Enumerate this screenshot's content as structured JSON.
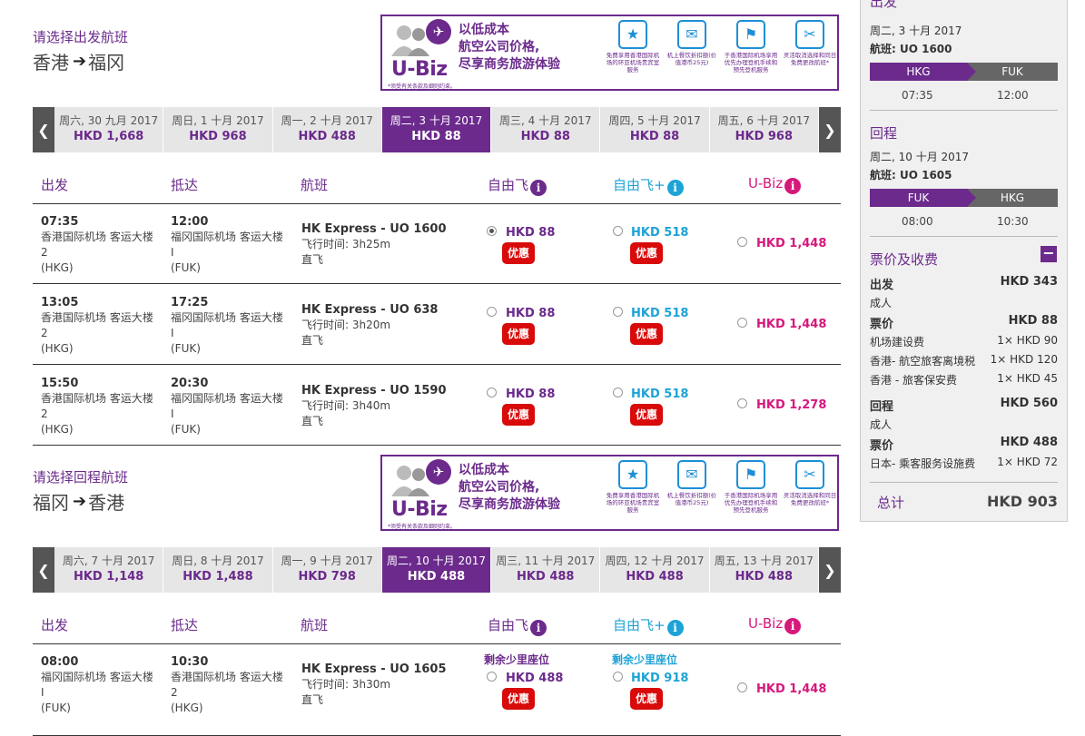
{
  "outbound": {
    "title": "请选择出发航班",
    "from": "香港",
    "to": "福冈",
    "dates": [
      {
        "date": "周六, 30 九月 2017",
        "price": "HKD 1,668"
      },
      {
        "date": "周日, 1 十月 2017",
        "price": "HKD 968"
      },
      {
        "date": "周一, 2 十月 2017",
        "price": "HKD 488"
      },
      {
        "date": "周二, 3 十月 2017",
        "price": "HKD 88",
        "selected": true
      },
      {
        "date": "周三, 4 十月 2017",
        "price": "HKD 88"
      },
      {
        "date": "周四, 5 十月 2017",
        "price": "HKD 88"
      },
      {
        "date": "周五, 6 十月 2017",
        "price": "HKD 968"
      }
    ],
    "flights": [
      {
        "dep_time": "07:35",
        "dep_airport": "香港国际机场 客运大楼 2",
        "dep_code": "(HKG)",
        "arr_time": "12:00",
        "arr_airport": "福冈国际机场 客运大楼 I",
        "arr_code": "(FUK)",
        "flight": "HK Express - UO 1600",
        "duration": "飞行时间: 3h25m",
        "stops": "直飞",
        "fare1": "HKD 88",
        "fare1_tag": "优惠",
        "fare2": "HKD 518",
        "fare2_tag": "优惠",
        "fare3": "HKD 1,448"
      },
      {
        "dep_time": "13:05",
        "dep_airport": "香港国际机场 客运大楼 2",
        "dep_code": "(HKG)",
        "arr_time": "17:25",
        "arr_airport": "福冈国际机场 客运大楼 I",
        "arr_code": "(FUK)",
        "flight": "HK Express - UO 638",
        "duration": "飞行时间: 3h20m",
        "stops": "直飞",
        "fare1": "HKD 88",
        "fare1_tag": "优惠",
        "fare2": "HKD 518",
        "fare2_tag": "优惠",
        "fare3": "HKD 1,448"
      },
      {
        "dep_time": "15:50",
        "dep_airport": "香港国际机场 客运大楼 2",
        "dep_code": "(HKG)",
        "arr_time": "20:30",
        "arr_airport": "福冈国际机场 客运大楼 I",
        "arr_code": "(FUK)",
        "flight": "HK Express - UO 1590",
        "duration": "飞行时间: 3h40m",
        "stops": "直飞",
        "fare1": "HKD 88",
        "fare1_tag": "优惠",
        "fare2": "HKD 518",
        "fare2_tag": "优惠",
        "fare3": "HKD 1,278"
      }
    ]
  },
  "return": {
    "title": "请选择回程航班",
    "from": "福冈",
    "to": "香港",
    "dates": [
      {
        "date": "周六, 7 十月 2017",
        "price": "HKD 1,148"
      },
      {
        "date": "周日, 8 十月 2017",
        "price": "HKD 1,488"
      },
      {
        "date": "周一, 9 十月 2017",
        "price": "HKD 798"
      },
      {
        "date": "周二, 10 十月 2017",
        "price": "HKD 488",
        "selected": true
      },
      {
        "date": "周三, 11 十月 2017",
        "price": "HKD 488"
      },
      {
        "date": "周四, 12 十月 2017",
        "price": "HKD 488"
      },
      {
        "date": "周五, 13 十月 2017",
        "price": "HKD 488"
      }
    ],
    "flights": [
      {
        "dep_time": "08:00",
        "dep_airport": "福冈国际机场 客运大楼 I",
        "dep_code": "(FUK)",
        "arr_time": "10:30",
        "arr_airport": "香港国际机场 客运大楼 2",
        "arr_code": "(HKG)",
        "flight": "HK Express - UO 1605",
        "duration": "飞行时间: 3h30m",
        "stops": "直飞",
        "fare1_note": "剩余少里座位",
        "fare1": "HKD 488",
        "fare1_tag": "优惠",
        "fare2_note": "剩余少里座位",
        "fare2": "HKD 918",
        "fare2_tag": "优惠",
        "fare3": "HKD 1,448"
      }
    ]
  },
  "table_headers": {
    "dep": "出发",
    "arr": "抵达",
    "flight": "航班",
    "fare1": "自由飞",
    "fare2": "自由飞+",
    "fare3": "U-Biz"
  },
  "banner": {
    "logo": "U-Biz",
    "slogan1": "以低成本",
    "slogan2": "航空公司价格,",
    "slogan3": "尽享商务旅游体验",
    "fine": "*须受有关条款及细则约束。",
    "features": [
      "免费享用香港国际机场的环亚机场贵宾室服务",
      "机上餐饮折扣额(价值港币25元)",
      "于香港国际机场享用优先办理登机手续和预先登机服务",
      "灵活取消选择和同日免费更改航班*"
    ]
  },
  "sidebar": {
    "dep_heading": "出发",
    "dep_date": "周二, 3 十月 2017",
    "dep_flight": "航班: UO 1600",
    "dep_from": "HKG",
    "dep_to": "FUK",
    "dep_time_from": "07:35",
    "dep_time_to": "12:00",
    "ret_heading": "回程",
    "ret_date": "周二, 10 十月 2017",
    "ret_flight": "航班: UO 1605",
    "ret_from": "FUK",
    "ret_to": "HKG",
    "ret_time_from": "08:00",
    "ret_time_to": "10:30",
    "fees_heading": "票价及收费",
    "collapse": "−",
    "fees": [
      {
        "label": "出发",
        "value": "HKD 343",
        "bold": true
      },
      {
        "label": "成人",
        "value": ""
      },
      {
        "label": "票价",
        "value": "HKD 88",
        "bold": true
      },
      {
        "label": "机场建设费",
        "value": "1× HKD 90"
      },
      {
        "label": "香港- 航空旅客离境税",
        "value": "1× HKD 120"
      },
      {
        "label": "香港 - 旅客保安费",
        "value": "1× HKD 45"
      },
      {
        "label": "回程",
        "value": "HKD 560",
        "bold": true
      },
      {
        "label": "成人",
        "value": ""
      },
      {
        "label": "票价",
        "value": "HKD 488",
        "bold": true
      },
      {
        "label": "日本- 乘客服务设施费",
        "value": "1× HKD 72"
      }
    ],
    "total_label": "总计",
    "total_value": "HKD 903"
  },
  "icons": {
    "prev": "chevron-left-icon",
    "next": "chevron-right-icon",
    "info": "info-icon",
    "arrow": "arrow-right-icon"
  },
  "colors": {
    "brand_purple": "#6b2a8c",
    "blue": "#1ea3d6",
    "pink": "#d6187c",
    "deal_red": "#d80a0a"
  }
}
